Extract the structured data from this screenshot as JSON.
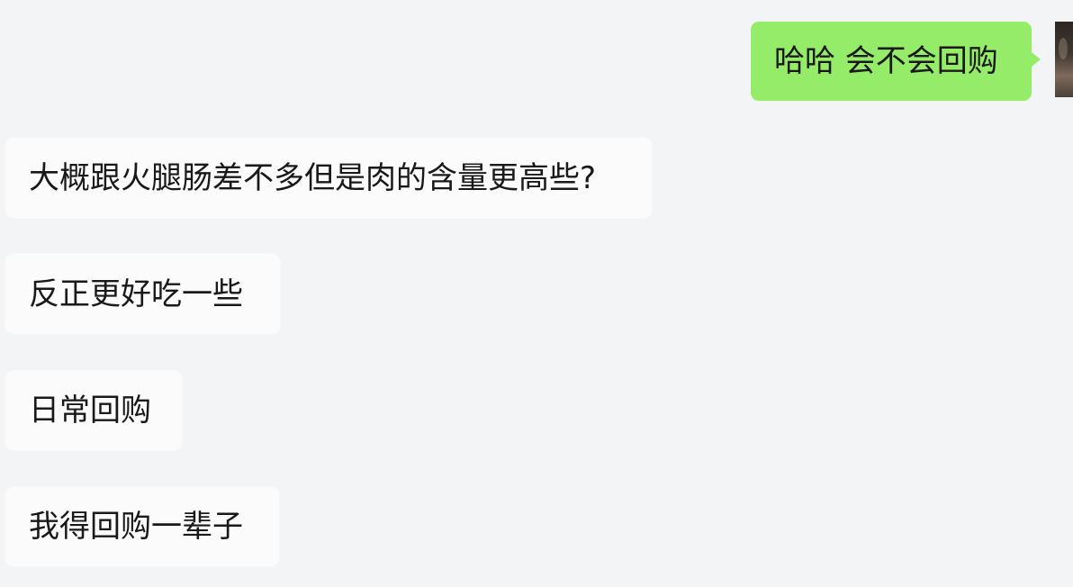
{
  "conversation": {
    "outgoing_message": "哈哈 会不会回购",
    "incoming_messages": [
      "大概跟火腿肠差不多但是肉的含量更高些?",
      "反正更好吃一些",
      "日常回购",
      "我得回购一辈子"
    ]
  },
  "colors": {
    "background": "#f3f4f6",
    "incoming_bubble": "#fbfbfb",
    "outgoing_bubble": "#95ec69",
    "text": "#191919"
  },
  "icons": {
    "tail": "right-pointing-triangle",
    "avatar": "cropped-profile-photo"
  }
}
